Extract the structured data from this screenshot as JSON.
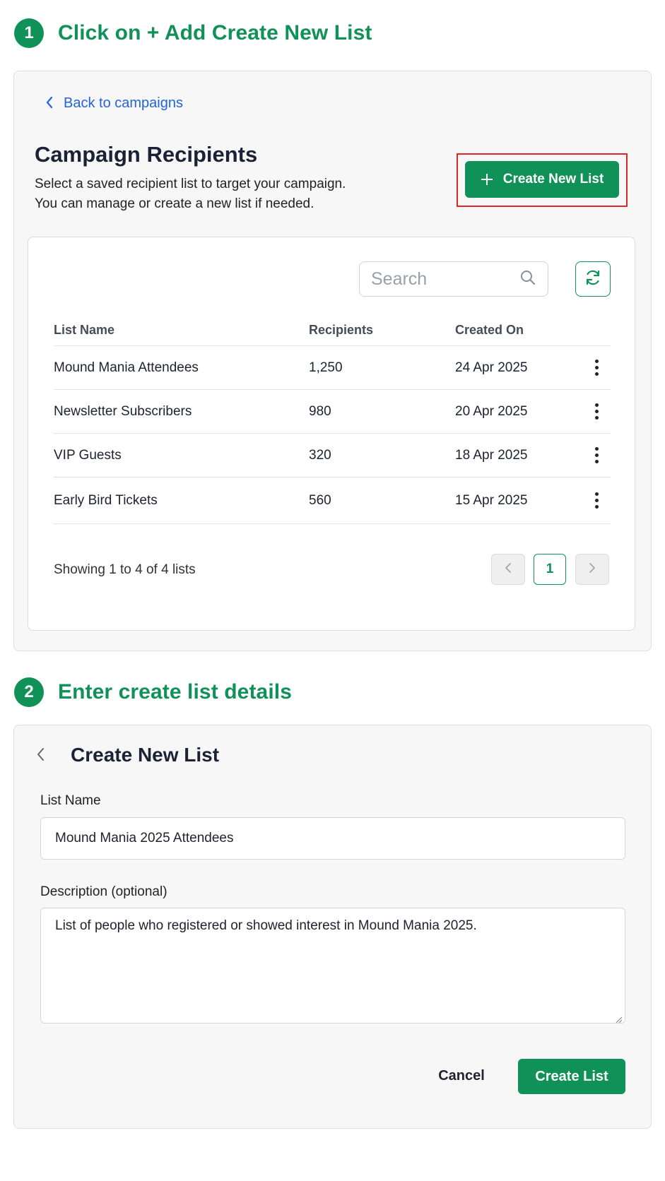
{
  "step1": {
    "number": "1",
    "title": "Click on + Add Create New List"
  },
  "step2": {
    "number": "2",
    "title": "Enter create list details"
  },
  "recipients": {
    "back_link": "Back to campaigns",
    "title": "Campaign Recipients",
    "subtitle_line1": "Select a saved recipient list to target your campaign.",
    "subtitle_line2": "You can manage or create a new list if needed.",
    "create_button": "Create New List",
    "search_placeholder": "Search",
    "columns": [
      "List Name",
      "Recipients",
      "Created On"
    ],
    "rows": [
      {
        "name": "Mound Mania Attendees",
        "recipients": "1,250",
        "created": "24 Apr 2025"
      },
      {
        "name": "Newsletter Subscribers",
        "recipients": "980",
        "created": "20 Apr 2025"
      },
      {
        "name": "VIP Guests",
        "recipients": "320",
        "created": "18 Apr 2025"
      },
      {
        "name": "Early Bird Tickets",
        "recipients": "560",
        "created": "15 Apr 2025"
      }
    ],
    "showing": "Showing 1 to 4 of 4 lists",
    "current_page": "1"
  },
  "form": {
    "title": "Create New List",
    "list_name_label": "List Name",
    "list_name_value": "Mound Mania 2025 Attendees",
    "description_label": "Description (optional)",
    "description_value": "List of people who registered or showed interest in Mound Mania 2025.",
    "cancel_label": "Cancel",
    "submit_label": "Create List"
  },
  "colors": {
    "brand_green": "#0f9158",
    "link_blue": "#2563d9",
    "highlight_red": "#e0262b"
  },
  "icons": [
    "chevron-left-icon",
    "plus-icon",
    "search-icon",
    "refresh-icon",
    "kebab-menu-icon",
    "chevron-right-icon",
    "resize-grip-icon"
  ]
}
